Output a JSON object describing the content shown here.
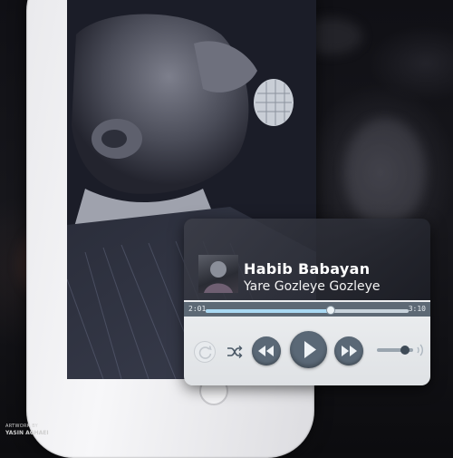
{
  "player": {
    "artist": "Habib Babayan",
    "track": "Yare Gozleye Gozleye",
    "time_elapsed": "2:01",
    "time_total": "3:10",
    "progress": 0.615,
    "volume": 0.78,
    "colors": {
      "progress_fill": "#a9d9f3",
      "control": "#5a6876",
      "bar": "#5d6975"
    },
    "icons": {
      "repeat": "repeat-icon",
      "shuffle": "shuffle-icon",
      "rewind": "rewind-icon",
      "play": "play-icon",
      "forward": "fast-forward-icon",
      "volume": "volume-icon"
    }
  },
  "credit": {
    "line1": "ARTWORK BY",
    "line2": "YASIN AGHAEI"
  }
}
